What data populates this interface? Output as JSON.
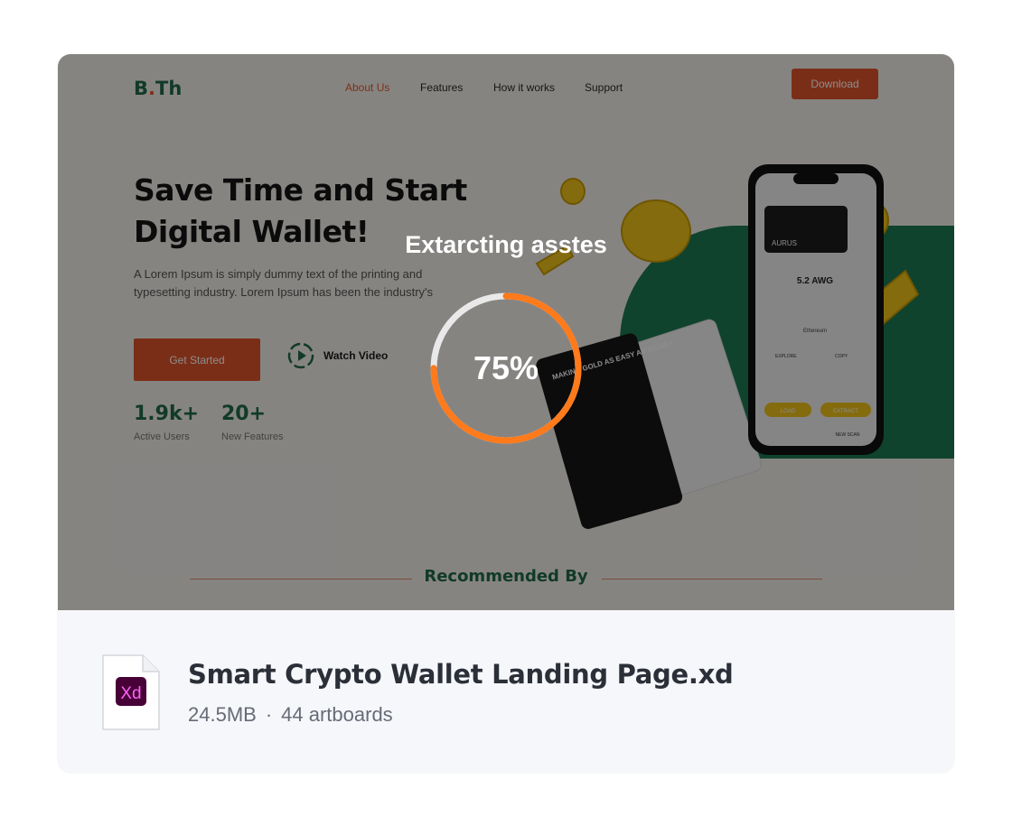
{
  "preview": {
    "logo": {
      "brand": "B",
      "dot": ".",
      "rest": "Th"
    },
    "nav": [
      "About Us",
      "Features",
      "How it works",
      "Support"
    ],
    "download_label": "Download",
    "hero_title_line1": "Save Time and Start",
    "hero_title_line2": "Digital Wallet!",
    "hero_desc": "A Lorem Ipsum is simply dummy text of the printing and typesetting industry. Lorem Ipsum has been the industry's",
    "cta_label": "Get Started",
    "watch_label": "Watch Video",
    "stats": [
      {
        "value": "1.9k+",
        "label": "Active Users"
      },
      {
        "value": "20+",
        "label": "New Features"
      }
    ],
    "card_text": "MAKING GOLD AS EASY AS MONEY",
    "phone": {
      "card_brand": "AURUS",
      "balance": "5.2 AWG",
      "section": "Ethereum",
      "explore": "EXPLORE",
      "copy": "COPY",
      "load": "LOAD",
      "extract": "EXTRACT",
      "new_scan": "NEW SCAN"
    },
    "recommended": "Recommended By"
  },
  "overlay": {
    "title": "Extarcting asstes",
    "progress_label": "75%",
    "progress": 0.75,
    "ring_color": "#ff7a1a"
  },
  "file": {
    "badge": "Xd",
    "name": "Smart Crypto Wallet Landing Page.xd",
    "size": "24.5MB",
    "separator": "·",
    "artboards": "44 artboards"
  }
}
